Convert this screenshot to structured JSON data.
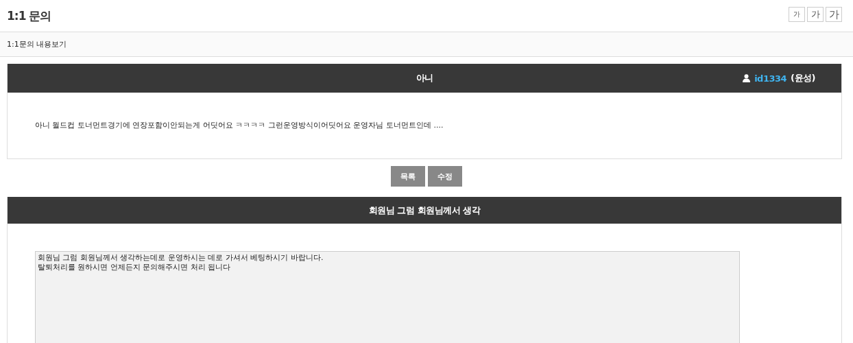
{
  "page_title": "1:1 문의",
  "font_size_buttons": [
    {
      "label": "가",
      "kind": "small"
    },
    {
      "label": "가",
      "kind": "medium"
    },
    {
      "label": "가",
      "kind": "large"
    }
  ],
  "breadcrumb": "1:1문의 내용보기",
  "question": {
    "title": "아니",
    "user_id": "id1334",
    "user_name": "(윤성)",
    "body": "아니 월드컵 토너먼트경기에 연장포함이안되는게 어딧어요 ㅋㅋㅋㅋ 그런운영방식이어딧어요 운영자님 토너먼트인데 ...."
  },
  "buttons": [
    "목록",
    "수정"
  ],
  "answer": {
    "title": "회원님 그럼 회원님께서 생각",
    "lines": [
      "회원님 그럼 회원님께서 생각하는데로 운영하시는 데로 가셔서 베팅하시기 바랍니다.",
      "탈퇴처리를 원하시면 언제든지 문의해주시면 처리 됩니다"
    ]
  }
}
